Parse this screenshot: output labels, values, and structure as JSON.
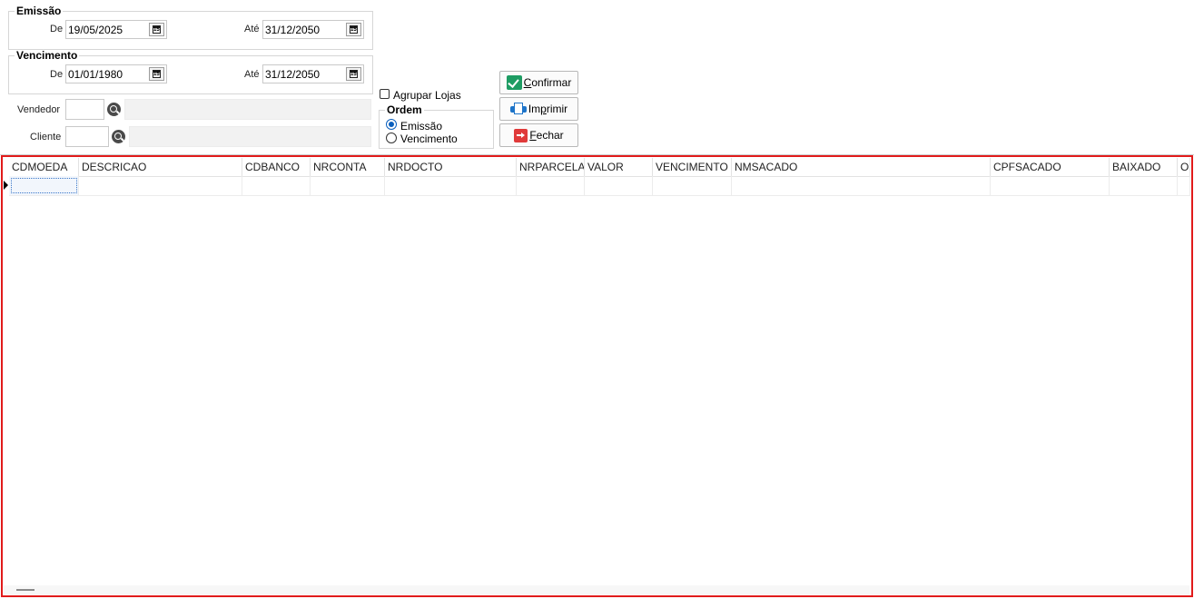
{
  "emissao": {
    "title": "Emissão",
    "de_label": "De",
    "de_value": "19/05/2025",
    "ate_label": "Até",
    "ate_value": "31/12/2050"
  },
  "vencimento": {
    "title": "Vencimento",
    "de_label": "De",
    "de_value": "01/01/1980",
    "ate_label": "Até",
    "ate_value": "31/12/2050"
  },
  "calendar_glyph": "15",
  "vendedor": {
    "label": "Vendedor"
  },
  "cliente": {
    "label": "Cliente"
  },
  "agrupar_lojas": {
    "label": "Agrupar Lojas",
    "checked": false
  },
  "ordem": {
    "title": "Ordem",
    "options": [
      {
        "label": "Emissão",
        "selected": true
      },
      {
        "label": "Vencimento",
        "selected": false
      }
    ]
  },
  "buttons": {
    "confirmar": {
      "prefix": "",
      "underlined": "C",
      "rest": "onfirmar"
    },
    "imprimir": {
      "prefix": "Im",
      "underlined": "p",
      "rest": "rimir"
    },
    "fechar": {
      "prefix": "",
      "underlined": "F",
      "rest": "echar"
    }
  },
  "grid": {
    "columns": [
      "CDMOEDA",
      "DESCRICAO",
      "CDBANCO",
      "NRCONTA",
      "NRDOCTO",
      "NRPARCELA",
      "VALOR",
      "VENCIMENTO",
      "NMSACADO",
      "CPFSACADO",
      "BAIXADO",
      "OS"
    ]
  }
}
